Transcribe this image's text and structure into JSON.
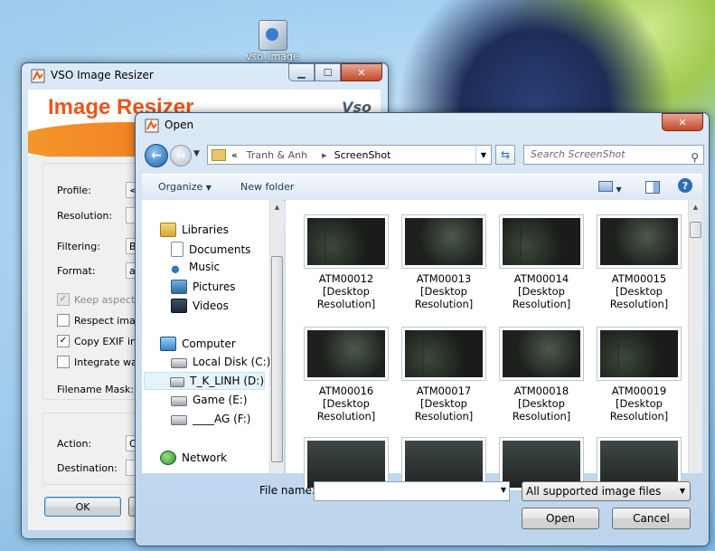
{
  "desktop": {
    "icon_label": "vso_image ..."
  },
  "vso_window": {
    "title": "VSO Image Resizer",
    "banner_text": "Image Resizer",
    "banner_logo": "Vso",
    "labels": {
      "profile": "Profile:",
      "resolution": "Resolution:",
      "filtering": "Filtering:",
      "format": "Format:",
      "filename_mask": "Filename Mask:",
      "action": "Action:",
      "destination": "Destination:"
    },
    "field_values": {
      "profile": "<",
      "filtering": "Bi",
      "format": "as",
      "action": "C"
    },
    "checkboxes": [
      {
        "label": "Keep aspect ra",
        "checked": true,
        "disabled": true
      },
      {
        "label": "Respect image",
        "checked": false,
        "disabled": false
      },
      {
        "label": "Copy EXIF info",
        "checked": true,
        "disabled": false
      },
      {
        "label": "Integrate wate",
        "checked": false,
        "disabled": false
      }
    ],
    "ok_label": "OK"
  },
  "open_dialog": {
    "title": "Open",
    "breadcrumb": [
      "Tranh & Anh",
      "ScreenShot"
    ],
    "breadcrumb_prefix": "«",
    "breadcrumb_separator": "▸",
    "search_placeholder": "Search ScreenShot",
    "toolbar": {
      "organize": "Organize",
      "new_folder": "New folder"
    },
    "nav_tree": {
      "libraries_label": "Libraries",
      "libraries": [
        "Documents",
        "Music",
        "Pictures",
        "Videos"
      ],
      "computer_label": "Computer",
      "drives": [
        "Local Disk (C:)",
        "T_K_LINH (D:)",
        "Game (E:)",
        "____AG (F:)"
      ],
      "selected_drive": "T_K_LINH (D:)",
      "network_label": "Network"
    },
    "files": [
      {
        "name": "ATM00012",
        "detail": "[Desktop",
        "detail2": "Resolution]"
      },
      {
        "name": "ATM00013",
        "detail": "[Desktop",
        "detail2": "Resolution]"
      },
      {
        "name": "ATM00014",
        "detail": "[Desktop",
        "detail2": "Resolution]"
      },
      {
        "name": "ATM00015",
        "detail": "[Desktop",
        "detail2": "Resolution]"
      },
      {
        "name": "ATM00016",
        "detail": "[Desktop",
        "detail2": "Resolution]"
      },
      {
        "name": "ATM00017",
        "detail": "[Desktop",
        "detail2": "Resolution]"
      },
      {
        "name": "ATM00018",
        "detail": "[Desktop",
        "detail2": "Resolution]"
      },
      {
        "name": "ATM00019",
        "detail": "[Desktop",
        "detail2": "Resolution]"
      }
    ],
    "filename_label": "File name:",
    "filename_value": "",
    "filter_value": "All supported image files",
    "open_button": "Open",
    "cancel_button": "Cancel"
  },
  "icons": {
    "window_minimize": "minimize-icon",
    "window_maximize": "maximize-icon",
    "window_close": "close-icon",
    "back": "back-arrow-icon",
    "forward": "forward-arrow-icon",
    "refresh": "refresh-icon",
    "search": "search-icon",
    "help": "help-icon"
  },
  "colors": {
    "accent": "#e8561c",
    "selection": "#e5f3fb",
    "titlebar_close": "#c24a2c"
  }
}
